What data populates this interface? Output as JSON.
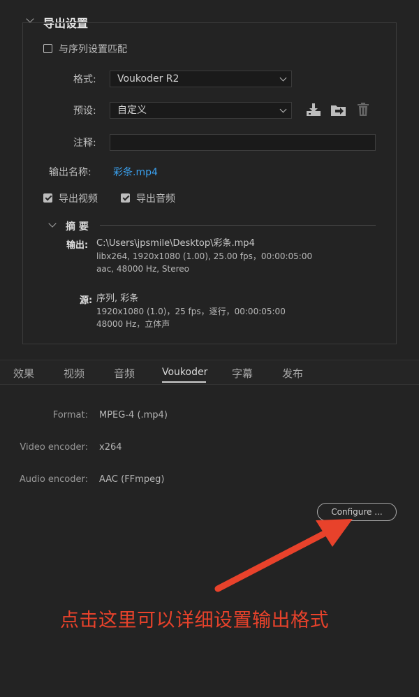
{
  "export_settings": {
    "title": "导出设置",
    "match_sequence": {
      "label": "与序列设置匹配",
      "checked": false
    },
    "format": {
      "label": "格式:",
      "value": "Voukoder R2"
    },
    "preset": {
      "label": "预设:",
      "value": "自定义"
    },
    "comments": {
      "label": "注释:",
      "value": ""
    },
    "output_name": {
      "label": "输出名称:",
      "value": "彩条.mp4"
    },
    "export_video": {
      "label": "导出视频",
      "checked": true
    },
    "export_audio": {
      "label": "导出音频",
      "checked": true
    },
    "summary": {
      "title": "摘 要",
      "output_label": "输出:",
      "output_lines": [
        "C:\\Users\\jpsmile\\Desktop\\彩条.mp4",
        "libx264, 1920x1080 (1.00), 25.00 fps，00:00:05:00",
        "aac, 48000 Hz, Stereo"
      ],
      "source_label": "源:",
      "source_lines": [
        "序列, 彩条",
        "1920x1080 (1.0)，25 fps，逐行，00:00:05:00",
        "48000 Hz，立体声"
      ]
    }
  },
  "tabs": [
    {
      "label": "效果",
      "active": false
    },
    {
      "label": "视频",
      "active": false
    },
    {
      "label": "音频",
      "active": false
    },
    {
      "label": "Voukoder",
      "active": true
    },
    {
      "label": "字幕",
      "active": false
    },
    {
      "label": "发布",
      "active": false
    }
  ],
  "voukoder_panel": {
    "format": {
      "label": "Format:",
      "value": "MPEG-4 (.mp4)"
    },
    "video_encoder": {
      "label": "Video encoder:",
      "value": "x264"
    },
    "audio_encoder": {
      "label": "Audio encoder:",
      "value": "AAC (FFmpeg)"
    },
    "configure_button": "Configure ..."
  },
  "annotation": {
    "text": "点击这里可以详细设置输出格式",
    "color": "#e8422b"
  },
  "icons": [
    "save-preset-icon",
    "import-preset-icon",
    "delete-preset-icon"
  ]
}
